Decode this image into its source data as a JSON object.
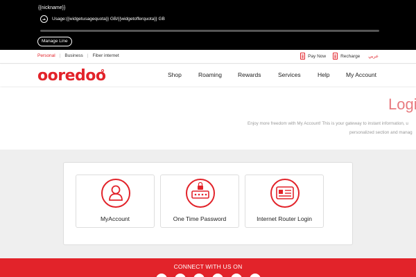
{
  "topbar": {
    "nickname": "{{nickname}}",
    "usage_text": "Usage:{{widgetusagequota}} GB/{{widgetofferquota}} GB",
    "manage_label": "Manage Line"
  },
  "subnav": {
    "segments": [
      "Personal",
      "Business",
      "Fiber internet"
    ],
    "pay_now": "Pay Now",
    "recharge": "Recharge",
    "language": "عربي"
  },
  "mainnav": {
    "logo": "ooredoo",
    "items": [
      "Shop",
      "Roaming",
      "Rewards",
      "Services",
      "Help",
      "My Account"
    ]
  },
  "hero": {
    "title": "Login",
    "desc_line1": "Enjoy more freedom with My Account! This is your gateway to instant information, u",
    "desc_line2": "personalized section and manag"
  },
  "cards": [
    {
      "label": "MyAccount",
      "icon": "user-icon"
    },
    {
      "label": "One Time Password",
      "icon": "password-lock-icon"
    },
    {
      "label": "Internet Router Login",
      "icon": "router-card-icon"
    }
  ],
  "footer": {
    "title": "CONNECT WITH US ON"
  },
  "colors": {
    "brand_red": "#e2232a",
    "topbar_bg": "#000000",
    "grey_bg": "#efefef"
  }
}
